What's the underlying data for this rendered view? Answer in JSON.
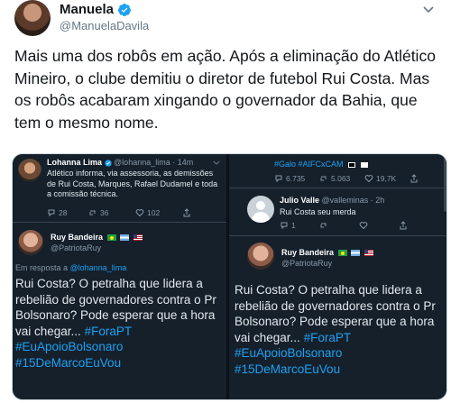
{
  "author": {
    "name": "Manuela",
    "handle": "@ManuelaDavila"
  },
  "tweet": {
    "text": "Mais uma dos robôs em ação. Após a eliminação do Atlético Mineiro, o clube demitiu o diretor de futebol Rui Costa. Mas os robôs acabaram xingando o governador da Bahia, que tem o mesmo nome."
  },
  "left_panel": {
    "quoted": {
      "name": "Lohanna Lima",
      "handle": "@lohanna_lima · 14m",
      "text": "Atlético informa, via assessoria, as demissões de Rui Costa, Marques, Rafael Dudamel e toda a comissão técnica.",
      "replies": "28",
      "retweets": "36",
      "likes": "102"
    },
    "reply": {
      "name": "Ruy Bandeira",
      "handle": "@PatriotaRuy",
      "reply_to_prefix": "Em resposta a ",
      "reply_to_handle": "@lohanna_lima",
      "text": "Rui Costa? O petralha que lidera a rebelião de governadores contra o Pr Bolsonaro? Pode esperar que a hora vai chegar...",
      "tags": [
        "#ForaPT",
        "#EuApoioBolsonaro",
        "#15DeMarcoEuVou"
      ]
    }
  },
  "right_panel": {
    "top_tags": "#Galo #AIFCxCAM",
    "top_stats": {
      "replies": "6.735",
      "retweets": "5.063",
      "likes": "19,7K"
    },
    "quoted": {
      "name": "Julio Valle",
      "handle": "@valleminas · 2h",
      "text": "Rui Costa seu merda",
      "replies": "1"
    },
    "reply": {
      "name": "Ruy Bandeira",
      "handle": "@PatriotaRuy",
      "text": "Rui Costa? O petralha que lidera a rebelião de governadores contra o Pr Bolsonaro? Pode esperar que a hora vai chegar...",
      "tags": [
        "#ForaPT",
        "#EuApoioBolsonaro",
        "#15DeMarcoEuVou"
      ]
    }
  },
  "colors": {
    "dark_bg": "#15202b",
    "link_blue": "#1da1f2",
    "muted": "#8899a6"
  }
}
